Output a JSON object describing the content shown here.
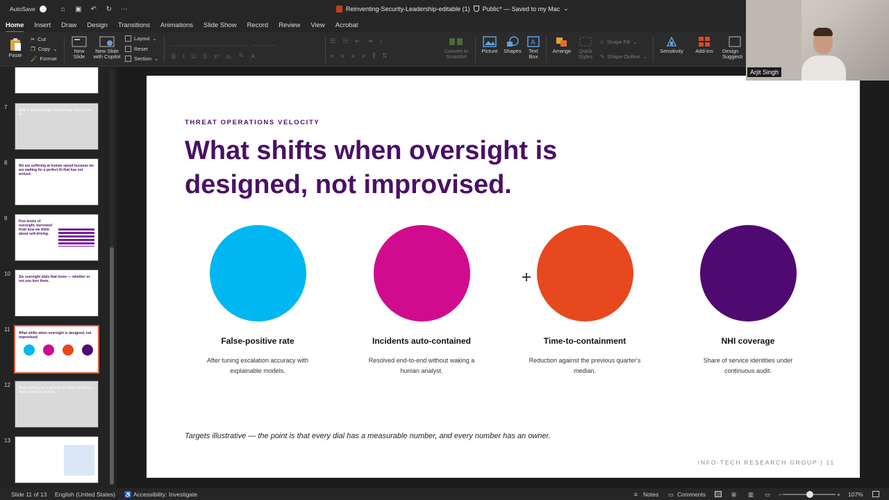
{
  "titlebar": {
    "autosave": "AutoSave",
    "document_title": "Reinventing-Security-Leadership-editable (1)",
    "save_status": "Public* — Saved to my Mac"
  },
  "tabs": [
    "Home",
    "Insert",
    "Draw",
    "Design",
    "Transitions",
    "Animations",
    "Slide Show",
    "Record",
    "Review",
    "View",
    "Acrobat"
  ],
  "ribbon": {
    "paste": "Paste",
    "cut": "Cut",
    "copy": "Copy",
    "format": "Format",
    "new_slide": "New Slide",
    "new_slide_copilot": "New Slide with Copilot",
    "layout": "Layout",
    "reset": "Reset",
    "section": "Section",
    "convert_smartart": "Convert to SmartArt",
    "picture": "Picture",
    "shapes": "Shapes",
    "text_box": "Text Box",
    "arrange": "Arrange",
    "quick_styles": "Quick Styles",
    "shape_fill": "Shape Fill",
    "shape_outline": "Shape Outline",
    "sensitivity": "Sensitivity",
    "add_ins": "Add-ins",
    "designer": "Design Suggesti"
  },
  "thumbnails": [
    {
      "number": "7",
      "text": "Why it also amongst Technology. Don't trust AI",
      "dimmed": true
    },
    {
      "number": "8",
      "text": "We are suffering at human speed because we are waiting for a perfect AI that has not arrived.",
      "dimmed": false
    },
    {
      "number": "9",
      "text": "Five levels of oversight, borrowed from how we think about self-driving.",
      "dimmed": false
    },
    {
      "number": "10",
      "text": "Six oversight dials that move — whether or not you turn them.",
      "dimmed": false
    },
    {
      "number": "11",
      "text": "What shifts when oversight is designed, not improvised.",
      "dimmed": false,
      "selected": true
    },
    {
      "number": "12",
      "text": "Stop waiting for a smarter AI. Start building a more resilient system.",
      "dimmed": true
    },
    {
      "number": "13",
      "text": "",
      "dimmed": false
    }
  ],
  "slide": {
    "eyebrow": "THREAT OPERATIONS VELOCITY",
    "title": "What shifts when oversight is designed, not improvised.",
    "metrics": [
      {
        "label": "False-positive rate",
        "description": "After tuning escalation accuracy with explainable models.",
        "color": "#00b7f1"
      },
      {
        "label": "Incidents auto-contained",
        "description": "Resolved end-to-end without waking a human analyst.",
        "color": "#d10b8e"
      },
      {
        "label": "Time-to-containment",
        "description": "Reduction against the previous quarter's median.",
        "color": "#e8481d"
      },
      {
        "label": "NHI coverage",
        "description": "Share of service identities under continuous audit.",
        "color": "#4f0a72"
      }
    ],
    "footnote": "Targets illustrative — the point is that every dial has a measurable number, and every number has an owner.",
    "brand": "INFO-TECH RESEARCH GROUP | 11"
  },
  "video": {
    "participant_name": "Arjit Singh"
  },
  "status": {
    "slide_counter": "Slide 11 of 13",
    "language": "English (United States)",
    "accessibility": "Accessibility: Investigate",
    "notes": "Notes",
    "comments": "Comments",
    "zoom": "107%"
  },
  "colors": {
    "accent_tab_underline": "#e05a2b",
    "title_purple": "#4a1066",
    "selected_thumb_border": "#e05a3a"
  }
}
